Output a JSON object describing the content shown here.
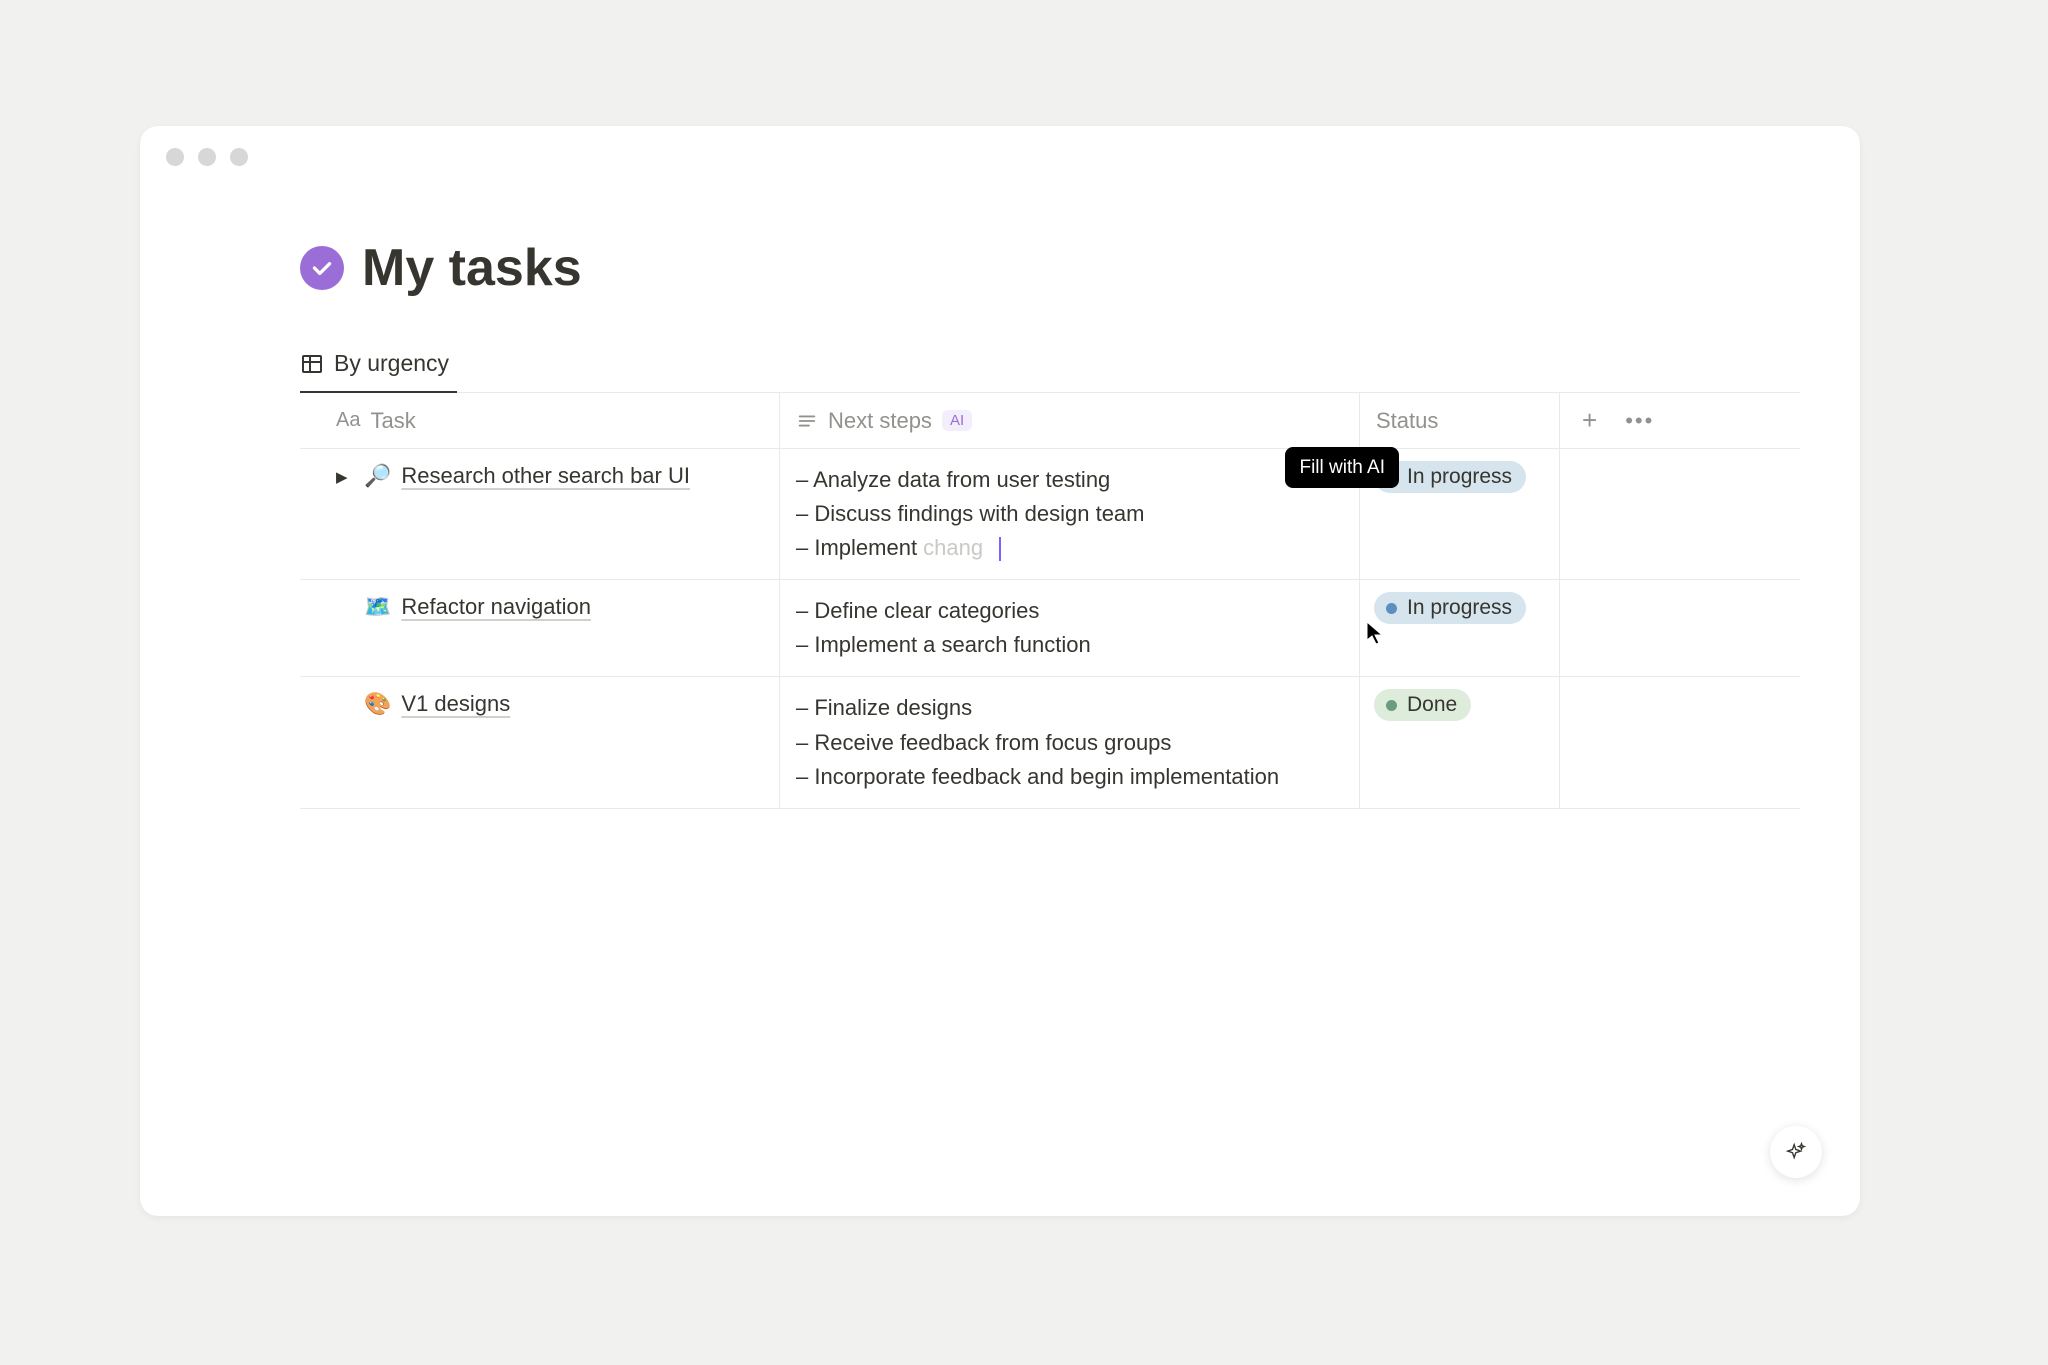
{
  "page": {
    "title": "My tasks"
  },
  "view": {
    "name": "By urgency"
  },
  "columns": {
    "task": "Task",
    "next": "Next steps",
    "ai_badge": "AI",
    "status": "Status"
  },
  "tooltip": {
    "fill_ai": "Fill with AI"
  },
  "rows": [
    {
      "emoji": "🔎",
      "title": "Research other search bar UI",
      "has_disclosure": true,
      "next_lines": [
        "– Analyze data from user testing",
        "– Discuss findings with design team"
      ],
      "typing_prefix": "– Implement ",
      "typing_ghost": "chang",
      "show_ai_button": true,
      "show_tooltip": true,
      "status": {
        "label": "In progress",
        "kind": "progress"
      }
    },
    {
      "emoji": "🗺️",
      "title": "Refactor navigation",
      "has_disclosure": false,
      "next_lines": [
        "– Define clear categories",
        "– Implement a search function"
      ],
      "status": {
        "label": "In progress",
        "kind": "progress"
      }
    },
    {
      "emoji": "🎨",
      "title": "V1 designs",
      "has_disclosure": false,
      "next_lines": [
        "– Finalize designs",
        "– Receive feedback from focus groups",
        "– Incorporate feedback and begin implementation"
      ],
      "status": {
        "label": "Done",
        "kind": "done"
      }
    }
  ]
}
